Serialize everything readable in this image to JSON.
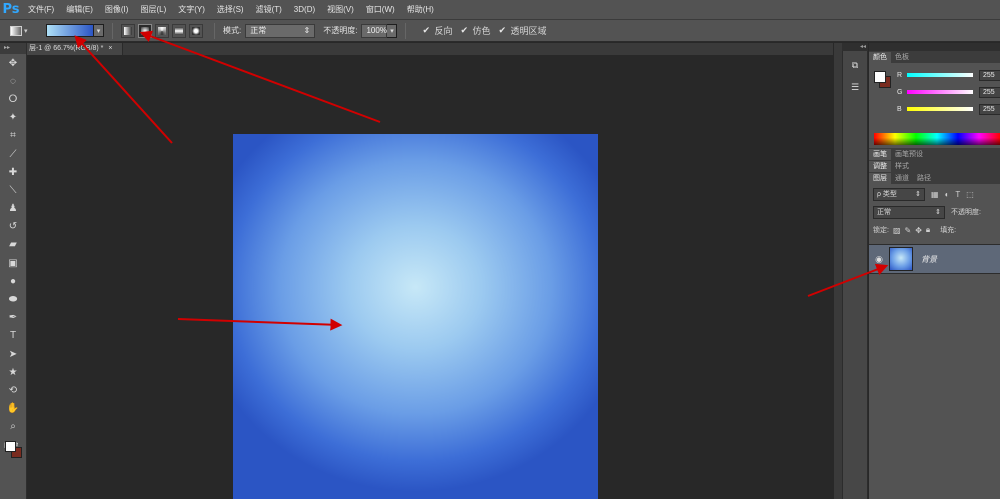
{
  "app": {
    "logo": "Ps"
  },
  "menu": [
    "文件(F)",
    "编辑(E)",
    "图像(I)",
    "图层(L)",
    "文字(Y)",
    "选择(S)",
    "滤镜(T)",
    "3D(D)",
    "视图(V)",
    "窗口(W)",
    "帮助(H)"
  ],
  "options": {
    "mode_label": "模式:",
    "mode_value": "正常",
    "opacity_label": "不透明度:",
    "opacity_value": "100%",
    "reverse_label": "反向",
    "dither_label": "仿色",
    "transparency_label": "透明区域",
    "gradient_start_color": "#aee0f7",
    "gradient_end_color": "#2b55c4"
  },
  "document": {
    "tab_label": "层-1 @ 66.7%(RGB/8) *",
    "close_glyph": "×"
  },
  "color_panel": {
    "tabs": [
      "颜色",
      "色板"
    ],
    "fg_color": "#ffffff",
    "bg_color": "#7a2b1f",
    "channels": [
      {
        "label": "R",
        "value": "255"
      },
      {
        "label": "G",
        "value": "255"
      },
      {
        "label": "B",
        "value": "255"
      }
    ]
  },
  "brush_panel": {
    "tabs": [
      "画笔",
      "画笔预设"
    ]
  },
  "adjust_panel": {
    "tabs": [
      "调整",
      "样式"
    ]
  },
  "layers_panel": {
    "tabs": [
      "图层",
      "通道",
      "路径"
    ],
    "filter_label": "ρ 类型",
    "blend_mode": "正常",
    "opacity_label": "不透明度:",
    "lock_label": "锁定:",
    "fill_label": "填充:",
    "layers": [
      {
        "name": "背景",
        "visible": true
      }
    ]
  }
}
